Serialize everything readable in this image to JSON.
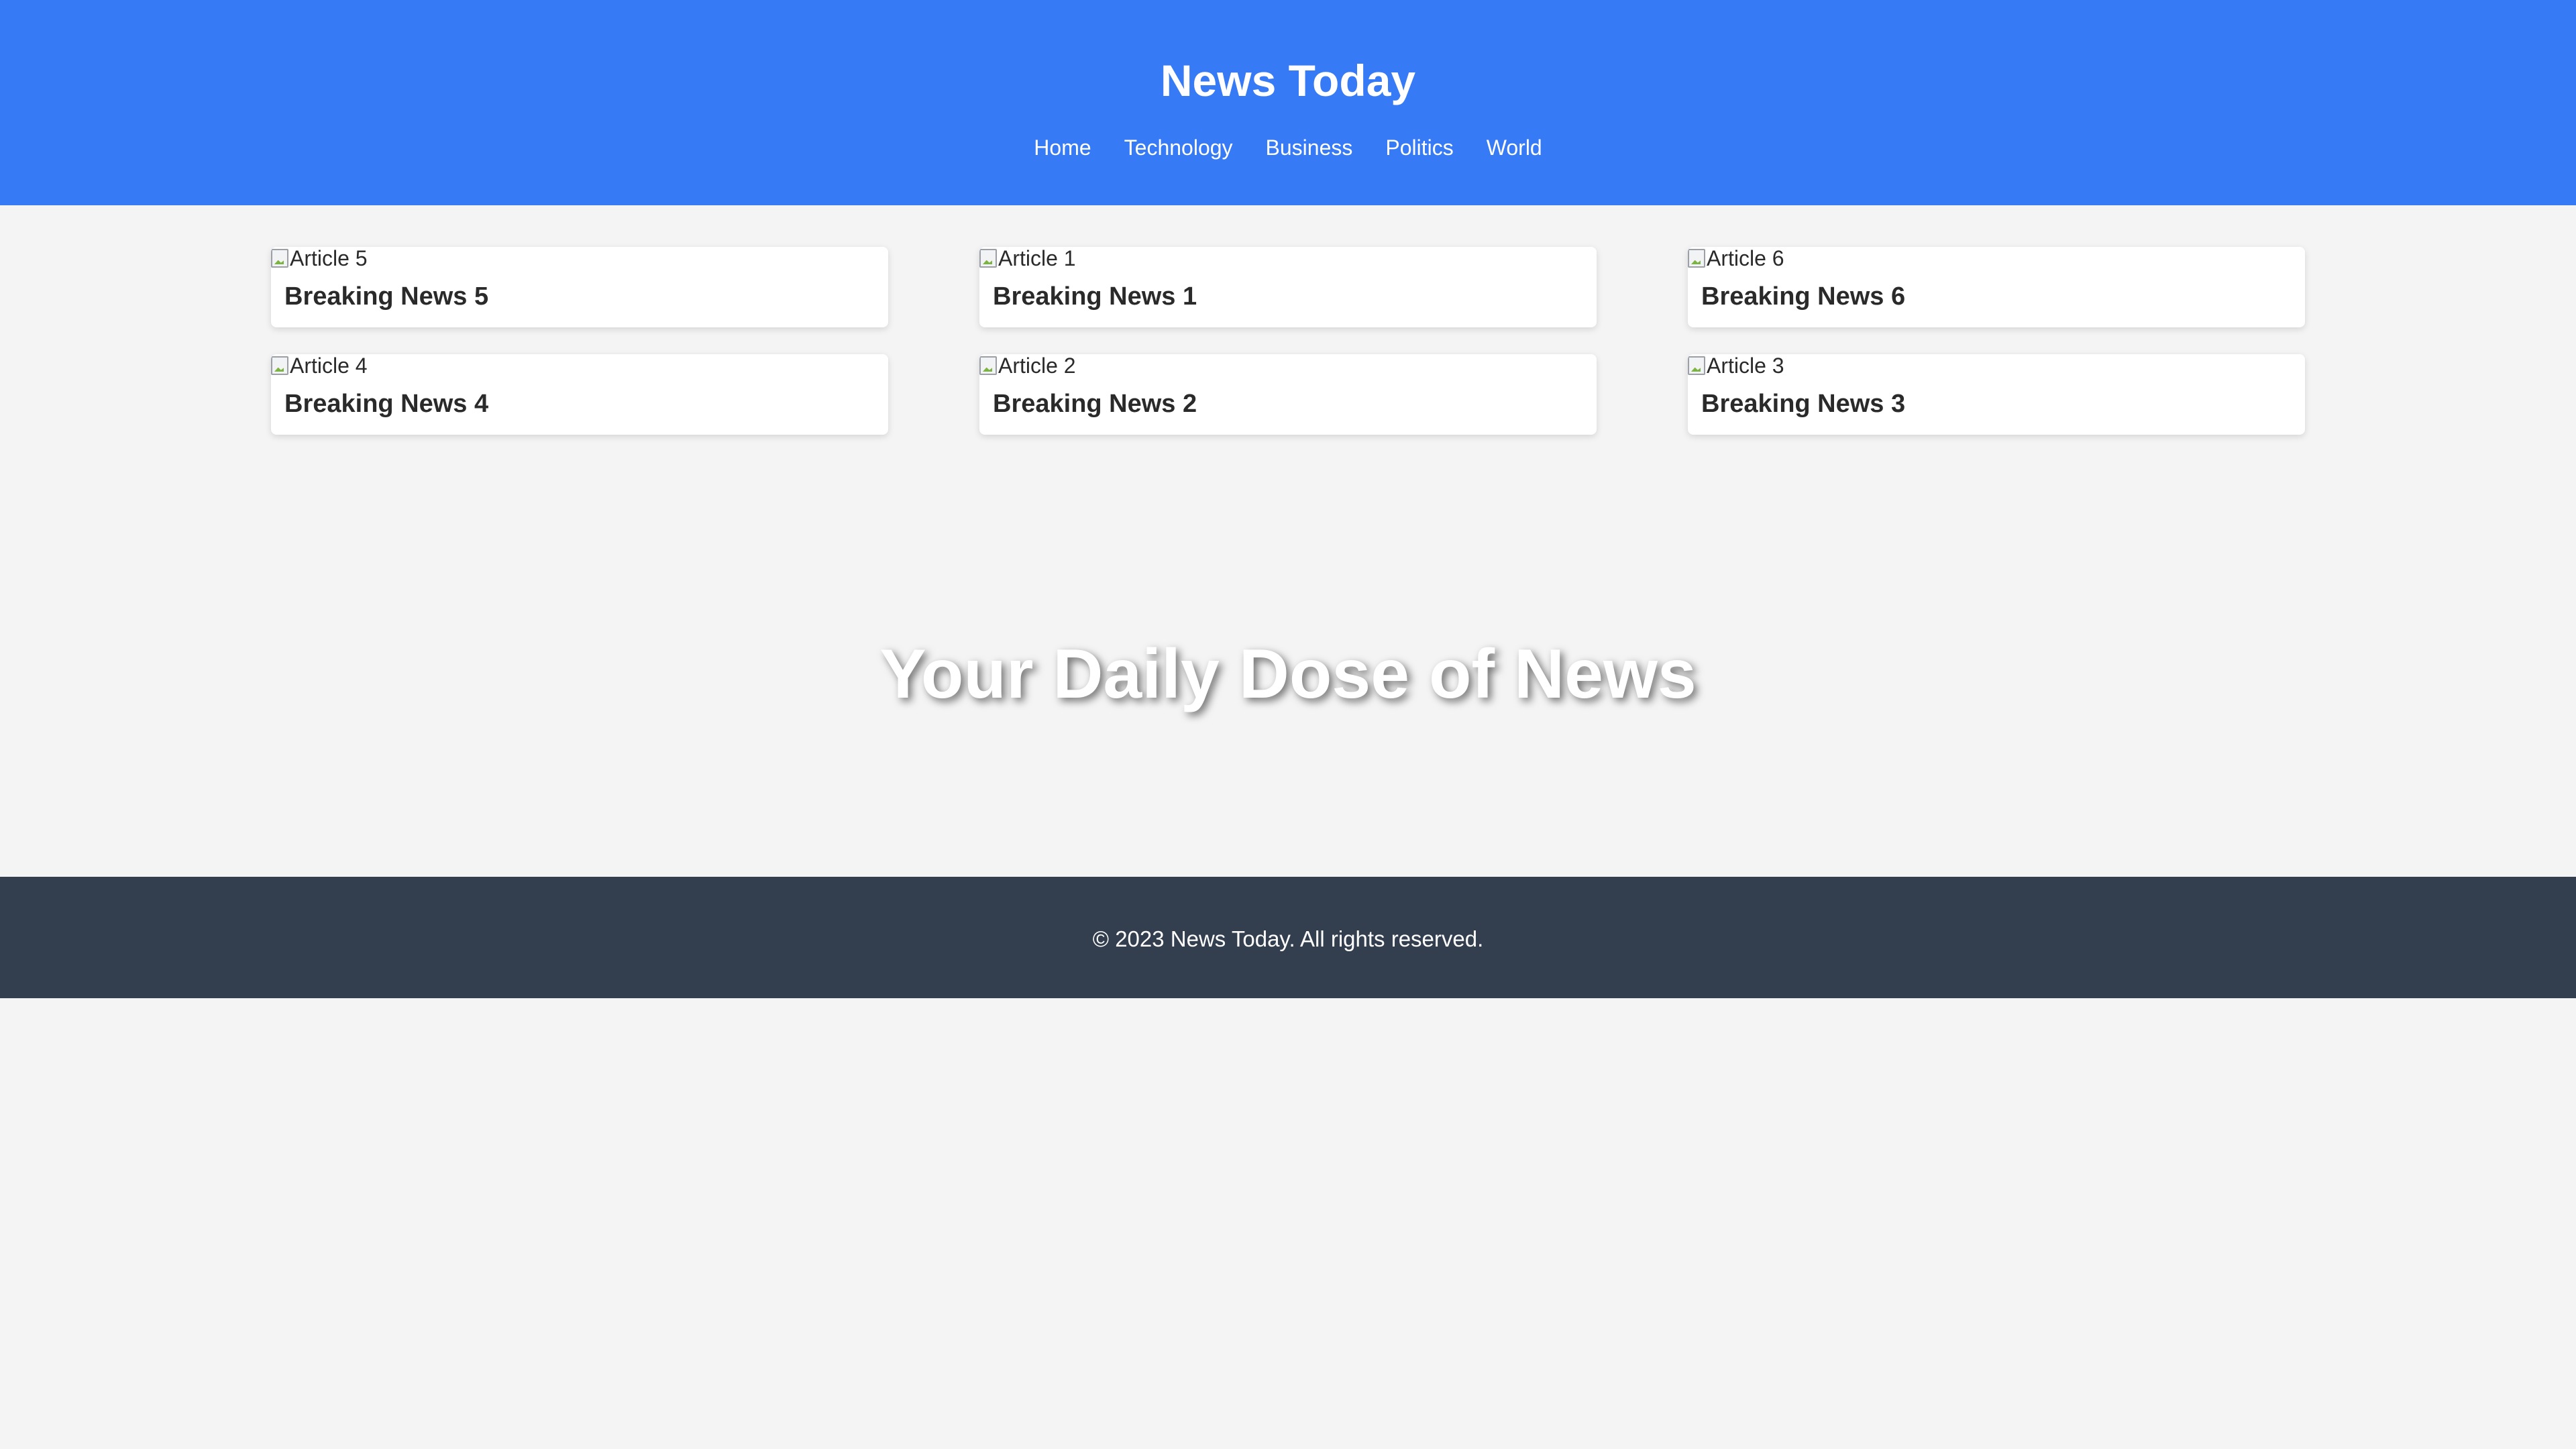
{
  "header": {
    "title": "News Today",
    "nav": [
      "Home",
      "Technology",
      "Business",
      "Politics",
      "World"
    ]
  },
  "articles": [
    {
      "image_alt": "Article 5",
      "title": "Breaking News 5"
    },
    {
      "image_alt": "Article 1",
      "title": "Breaking News 1"
    },
    {
      "image_alt": "Article 6",
      "title": "Breaking News 6"
    },
    {
      "image_alt": "Article 4",
      "title": "Breaking News 4"
    },
    {
      "image_alt": "Article 2",
      "title": "Breaking News 2"
    },
    {
      "image_alt": "Article 3",
      "title": "Breaking News 3"
    }
  ],
  "hero": {
    "text": "Your Daily Dose of News"
  },
  "footer": {
    "text": "© 2023 News Today. All rights reserved."
  },
  "colors": {
    "header_bg": "#377af6",
    "footer_bg": "#333f4f",
    "page_bg": "#f4f4f4"
  }
}
